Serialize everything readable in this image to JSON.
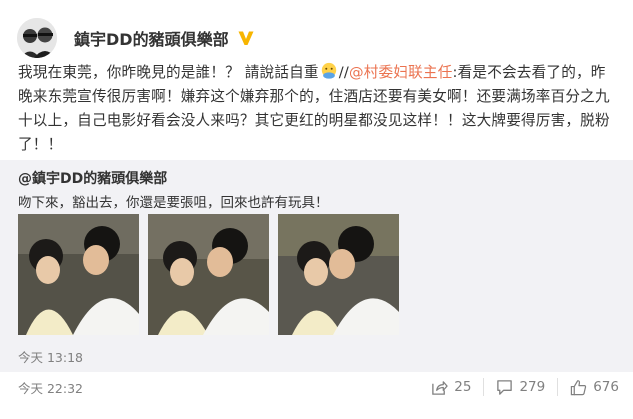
{
  "author": {
    "name": "鎮宇DD的豬頭俱樂部",
    "verified": true,
    "badge_color": "#f7b500"
  },
  "post": {
    "text_before_emoji": "我現在東莞，你昨晚見的是誰！？ 請說話自重",
    "text_slashes": "//",
    "mention": "@村委妇联主任",
    "text_after_mention": ":看是不会去看了的，昨晚来东莞宣传很厉害啊！嫌弃这个嫌弃那个的，住酒店还要有美女啊！还要满场率百分之九十以上，自己电影好看会没人来吗？其它更红的明星都没见这样！！这大牌要得厉害，脱粉了！！",
    "emoji": "hand-over-mouth-emoji",
    "time": "今天 22:32"
  },
  "repost": {
    "user": "@鎮宇DD的豬頭俱樂部",
    "text": "吻下來，豁出去，你還是要張咀，回來也許有玩具！",
    "time": "今天 13:18",
    "photos": [
      "photo-1",
      "photo-2",
      "photo-3"
    ]
  },
  "actions": {
    "share_icon": "share-icon",
    "share_count": "25",
    "comment_icon": "comment-icon",
    "comment_count": "279",
    "like_icon": "thumbs-up-icon",
    "like_count": "676"
  },
  "colors": {
    "mention": "#eb7350",
    "meta": "#808080",
    "repost_bg": "#f2f2f5"
  }
}
